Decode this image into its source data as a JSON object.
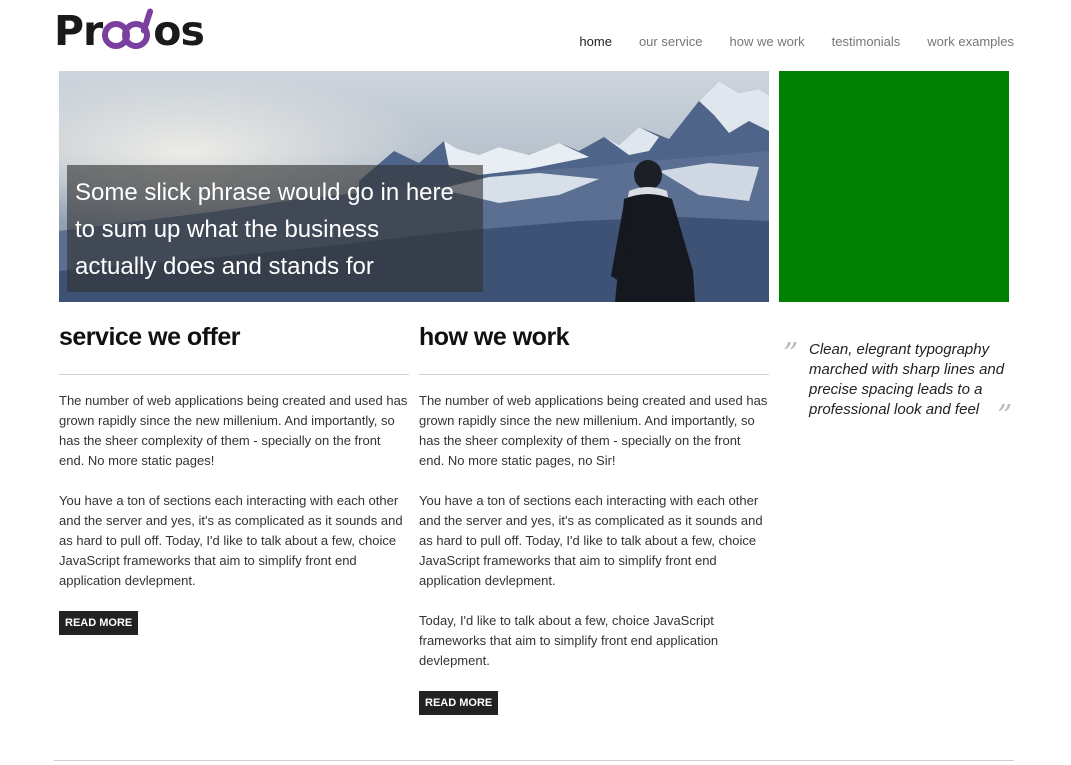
{
  "brand": {
    "logo_prefix": "Pr",
    "logo_suffix": "os",
    "accent": "#7b3fa0"
  },
  "nav": {
    "items": [
      {
        "label": "home",
        "active": true
      },
      {
        "label": "our service",
        "active": false
      },
      {
        "label": "how we work",
        "active": false
      },
      {
        "label": "testimonials",
        "active": false
      },
      {
        "label": "work examples",
        "active": false
      }
    ]
  },
  "hero": {
    "caption_lines": [
      "Some slick phrase would go in here",
      "to sum up what the business",
      "actually does and stands for"
    ]
  },
  "side_panel": {
    "color": "#008000"
  },
  "services": {
    "title": "service we offer",
    "paragraphs": [
      "The number of web applications being created and used has grown rapidly since the new millenium. And importantly, so has the sheer complexity of them - specially on the front end. No more static pages!",
      "You have a ton of sections each interacting with each other and the server and yes, it's as complicated as it sounds and as hard to pull off. Today, I'd like to talk about a few, choice JavaScript frameworks that aim to simplify front end application devlepment."
    ],
    "button": "READ MORE"
  },
  "how_we_work": {
    "title": "how we work",
    "paragraphs": [
      "The number of web applications being created and used has grown rapidly since the new millenium. And importantly, so has the sheer complexity of them - specially on the front end. No more static pages, no Sir!",
      "You have a ton of sections each interacting with each other and the server and yes, it's as complicated as it sounds and as hard to pull off. Today, I'd like to talk about a few, choice JavaScript frameworks that aim to simplify front end application devlepment.",
      "Today, I'd like to talk about a few, choice JavaScript frameworks that aim to simplify front end application devlepment."
    ],
    "button": "READ MORE"
  },
  "quote": {
    "open_mark": "”",
    "close_mark": "”",
    "text": "Clean, elegrant typography marched with sharp lines and precise spacing leads to a professional look and feel"
  }
}
